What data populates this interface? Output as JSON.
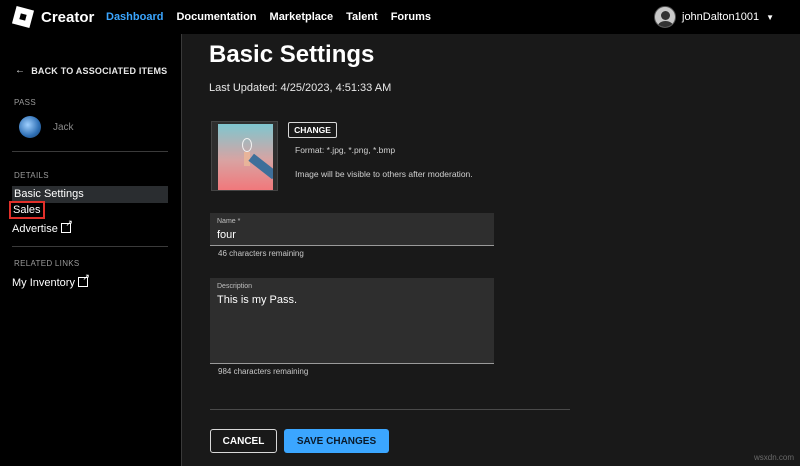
{
  "nav": {
    "brand": "Creator",
    "links": [
      "Dashboard",
      "Documentation",
      "Marketplace",
      "Talent",
      "Forums"
    ],
    "active_link": "Dashboard",
    "username": "johnDalton1001",
    "accent": "#3ba6ff"
  },
  "sidebar": {
    "back": "BACK TO ASSOCIATED ITEMS",
    "pass_label": "PASS",
    "pass_name": "Jack",
    "details_label": "DETAILS",
    "details_items": [
      "Basic Settings",
      "Sales",
      "Advertise"
    ],
    "related_label": "RELATED LINKS",
    "related_items": [
      "My Inventory"
    ],
    "highlight_color": "#e1302a"
  },
  "main": {
    "title": "Basic Settings",
    "last_updated": "Last Updated: 4/25/2023, 4:51:33 AM",
    "change_label": "CHANGE",
    "format_text": "Format: *.jpg, *.png, *.bmp",
    "visibility_text": "Image will be visible to others after moderation.",
    "name_label": "Name *",
    "name_value": "four",
    "name_remaining": "46 characters remaining",
    "desc_label": "Description",
    "desc_value": "This is my Pass.",
    "desc_remaining": "984 characters remaining",
    "cancel_label": "CANCEL",
    "save_label": "SAVE CHANGES"
  },
  "watermark": "wsxdn.com"
}
